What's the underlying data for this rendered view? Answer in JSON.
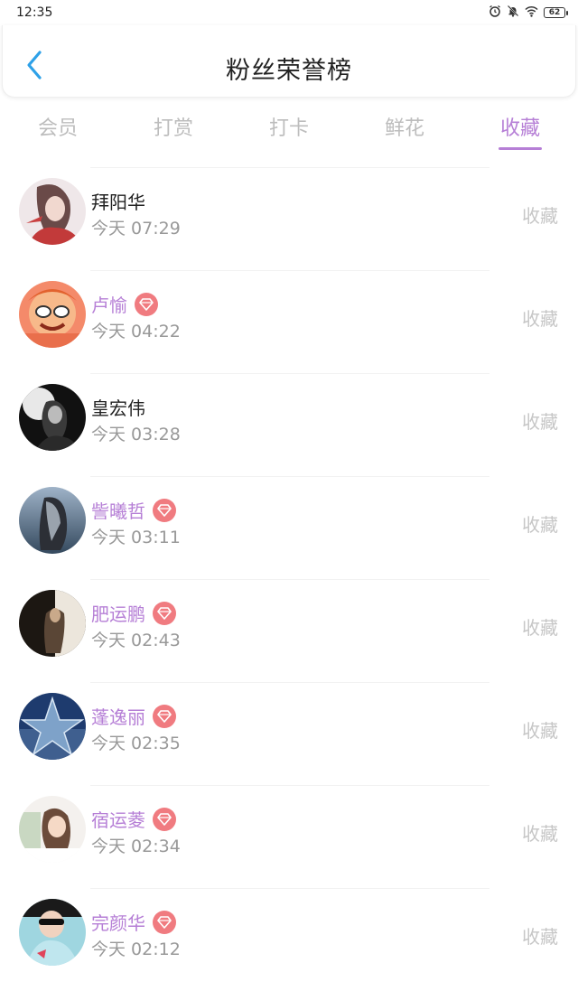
{
  "status_bar": {
    "time": "12:35",
    "battery": "62",
    "icons": [
      "alarm-icon",
      "mute-bell-icon",
      "wifi-icon",
      "battery-icon"
    ]
  },
  "header": {
    "title": "粉丝荣誉榜",
    "back_icon": "chevron-left-icon"
  },
  "colors": {
    "accent": "#b67fd6",
    "badge": "#f07b80",
    "back_arrow": "#2ea1e8",
    "muted": "#c6c6c6"
  },
  "tabs": [
    {
      "label": "会员",
      "active": false
    },
    {
      "label": "打赏",
      "active": false
    },
    {
      "label": "打卡",
      "active": false
    },
    {
      "label": "鲜花",
      "active": false
    },
    {
      "label": "收藏",
      "active": true
    }
  ],
  "fans": [
    {
      "name": "拜阳华",
      "time": "今天 07:29",
      "action": "收藏",
      "vip": false
    },
    {
      "name": "卢愉",
      "time": "今天 04:22",
      "action": "收藏",
      "vip": true
    },
    {
      "name": "皇宏伟",
      "time": "今天 03:28",
      "action": "收藏",
      "vip": false
    },
    {
      "name": "訾曦哲",
      "time": "今天 03:11",
      "action": "收藏",
      "vip": true
    },
    {
      "name": "肥运鹏",
      "time": "今天 02:43",
      "action": "收藏",
      "vip": true
    },
    {
      "name": "蓬逸丽",
      "time": "今天 02:35",
      "action": "收藏",
      "vip": true
    },
    {
      "name": "宿运菱",
      "time": "今天 02:34",
      "action": "收藏",
      "vip": true
    },
    {
      "name": "完颜华",
      "time": "今天 02:12",
      "action": "收藏",
      "vip": true
    }
  ]
}
